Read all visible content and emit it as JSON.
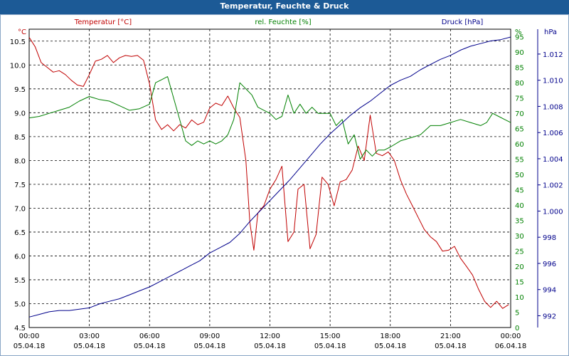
{
  "window": {
    "title": "Temperatur, Feuchte & Druck"
  },
  "colors": {
    "temperature": "#c00000",
    "humidity": "#008000",
    "pressure": "#00008b",
    "text": "#000000",
    "grid": "#000000",
    "titlebar": "#1c5a96"
  },
  "chart_data": {
    "type": "line",
    "title": "Temperatur, Feuchte & Druck",
    "grid": true,
    "x_ticks": [
      {
        "time": "00:00",
        "date": "05.04.18"
      },
      {
        "time": "03:00",
        "date": "05.04.18"
      },
      {
        "time": "06:00",
        "date": "05.04.18"
      },
      {
        "time": "09:00",
        "date": "05.04.18"
      },
      {
        "time": "12:00",
        "date": "05.04.18"
      },
      {
        "time": "15:00",
        "date": "05.04.18"
      },
      {
        "time": "18:00",
        "date": "05.04.18"
      },
      {
        "time": "21:00",
        "date": "05.04.18"
      },
      {
        "time": "00:00",
        "date": "06.04.18"
      }
    ],
    "x_range_hours": [
      0,
      24
    ],
    "axes": {
      "temperature": {
        "unit": "°C",
        "label": "Temperatur [°C]",
        "range": [
          4.5,
          10.75
        ],
        "ticks": [
          "4.5",
          "5.0",
          "5.5",
          "6.0",
          "6.5",
          "7.0",
          "7.5",
          "8.0",
          "8.5",
          "9.0",
          "9.5",
          "10.0",
          "10.5"
        ]
      },
      "humidity": {
        "unit": "%",
        "label": "rel. Feuchte [%]",
        "range": [
          0,
          97.5
        ],
        "ticks": [
          "0",
          "5",
          "10",
          "15",
          "20",
          "25",
          "30",
          "35",
          "40",
          "45",
          "50",
          "55",
          "60",
          "65",
          "70",
          "75",
          "80",
          "85",
          "90",
          "95"
        ]
      },
      "pressure": {
        "unit": "hPa",
        "label": "Druck [hPa]",
        "range": [
          991.1,
          1013.9
        ],
        "ticks": [
          "992",
          "994",
          "996",
          "998",
          "1.000",
          "1.002",
          "1.004",
          "1.006",
          "1.008",
          "1.010",
          "1.012"
        ]
      }
    },
    "series": [
      {
        "name": "Temperatur [°C]",
        "axis": "temperature",
        "hours": [
          0,
          0.3,
          0.6,
          0.9,
          1.2,
          1.5,
          1.8,
          2.1,
          2.4,
          2.7,
          3.0,
          3.3,
          3.6,
          3.9,
          4.2,
          4.5,
          4.8,
          5.1,
          5.4,
          5.7,
          6.0,
          6.3,
          6.6,
          6.9,
          7.2,
          7.5,
          7.8,
          8.1,
          8.4,
          8.7,
          9.0,
          9.3,
          9.6,
          9.9,
          10.2,
          10.5,
          10.8,
          11.0,
          11.2,
          11.4,
          11.7,
          12.0,
          12.3,
          12.6,
          12.9,
          13.2,
          13.4,
          13.7,
          14.0,
          14.3,
          14.6,
          14.9,
          15.2,
          15.5,
          15.8,
          16.1,
          16.4,
          16.7,
          17.0,
          17.3,
          17.6,
          17.9,
          18.2,
          18.5,
          18.8,
          19.1,
          19.4,
          19.7,
          20.0,
          20.3,
          20.6,
          20.9,
          21.2,
          21.5,
          21.8,
          22.1,
          22.4,
          22.7,
          23.0,
          23.3,
          23.6,
          23.9
        ],
        "values": [
          10.58,
          10.38,
          10.05,
          9.95,
          9.85,
          9.88,
          9.8,
          9.68,
          9.58,
          9.55,
          9.8,
          10.08,
          10.12,
          10.2,
          10.05,
          10.15,
          10.2,
          10.18,
          10.2,
          10.1,
          9.6,
          8.85,
          8.65,
          8.75,
          8.62,
          8.75,
          8.68,
          8.85,
          8.75,
          8.8,
          9.1,
          9.2,
          9.15,
          9.35,
          9.1,
          8.9,
          8.0,
          6.7,
          6.12,
          6.9,
          7.05,
          7.4,
          7.6,
          7.88,
          6.3,
          6.5,
          7.4,
          7.5,
          6.15,
          6.45,
          7.65,
          7.5,
          7.05,
          7.55,
          7.6,
          7.8,
          8.3,
          8.0,
          8.95,
          8.15,
          8.1,
          8.18,
          8.0,
          7.6,
          7.3,
          7.05,
          6.8,
          6.55,
          6.4,
          6.3,
          6.1,
          6.12,
          6.2,
          5.95,
          5.78,
          5.6,
          5.3,
          5.05,
          4.92,
          5.05,
          4.9,
          4.98
        ]
      },
      {
        "name": "rel. Feuchte [%]",
        "axis": "humidity",
        "hours": [
          0,
          0.5,
          1.0,
          1.5,
          2.0,
          2.5,
          3.0,
          3.5,
          4.0,
          4.5,
          5.0,
          5.5,
          6.0,
          6.3,
          6.6,
          6.9,
          7.2,
          7.5,
          7.8,
          8.1,
          8.4,
          8.7,
          9.0,
          9.3,
          9.6,
          9.9,
          10.2,
          10.5,
          10.8,
          11.1,
          11.4,
          11.7,
          12.0,
          12.3,
          12.6,
          12.9,
          13.2,
          13.5,
          13.8,
          14.1,
          14.4,
          14.7,
          15.0,
          15.3,
          15.6,
          15.9,
          16.2,
          16.5,
          16.8,
          17.1,
          17.4,
          17.7,
          18.0,
          18.5,
          19.0,
          19.5,
          20.0,
          20.5,
          21.0,
          21.5,
          22.0,
          22.5,
          22.8,
          23.1,
          23.4,
          23.7,
          24.0
        ],
        "values": [
          68.5,
          69,
          70,
          71,
          72,
          74,
          75.5,
          74.5,
          74,
          72.5,
          71,
          71.5,
          73,
          80,
          81,
          82,
          75,
          68,
          61,
          59.5,
          61,
          60,
          61,
          60,
          61,
          63,
          68,
          80,
          78,
          76,
          72,
          71,
          70,
          68,
          69,
          76,
          70,
          73,
          70,
          72,
          70,
          70,
          70,
          66,
          68,
          60,
          63,
          55,
          58,
          56,
          58,
          58,
          59,
          61,
          62,
          63,
          66,
          66,
          67,
          68,
          67,
          66,
          67,
          70,
          69,
          68,
          67
        ]
      },
      {
        "name": "Druck [hPa]",
        "axis": "pressure",
        "hours": [
          0,
          0.5,
          1.0,
          1.5,
          2.0,
          2.5,
          3.0,
          3.5,
          4.0,
          4.5,
          5.0,
          5.5,
          6.0,
          6.5,
          7.0,
          7.5,
          8.0,
          8.5,
          9.0,
          9.5,
          10.0,
          10.5,
          11.0,
          11.5,
          12.0,
          12.5,
          13.0,
          13.5,
          14.0,
          14.5,
          15.0,
          15.5,
          16.0,
          16.5,
          17.0,
          17.5,
          18.0,
          18.5,
          19.0,
          19.5,
          20.0,
          20.5,
          21.0,
          21.5,
          22.0,
          22.5,
          23.0,
          23.5,
          24.0
        ],
        "values": [
          991.9,
          992.1,
          992.3,
          992.4,
          992.4,
          992.5,
          992.6,
          992.9,
          993.1,
          993.3,
          993.6,
          993.9,
          994.2,
          994.6,
          995.0,
          995.4,
          995.8,
          996.2,
          996.8,
          997.2,
          997.6,
          998.3,
          999.2,
          1000.0,
          1000.8,
          1001.6,
          1002.4,
          1003.3,
          1004.2,
          1005.1,
          1005.9,
          1006.6,
          1007.3,
          1007.9,
          1008.4,
          1009.0,
          1009.6,
          1010.0,
          1010.3,
          1010.8,
          1011.2,
          1011.6,
          1011.9,
          1012.3,
          1012.6,
          1012.8,
          1013.0,
          1013.1,
          1013.3
        ]
      }
    ]
  }
}
